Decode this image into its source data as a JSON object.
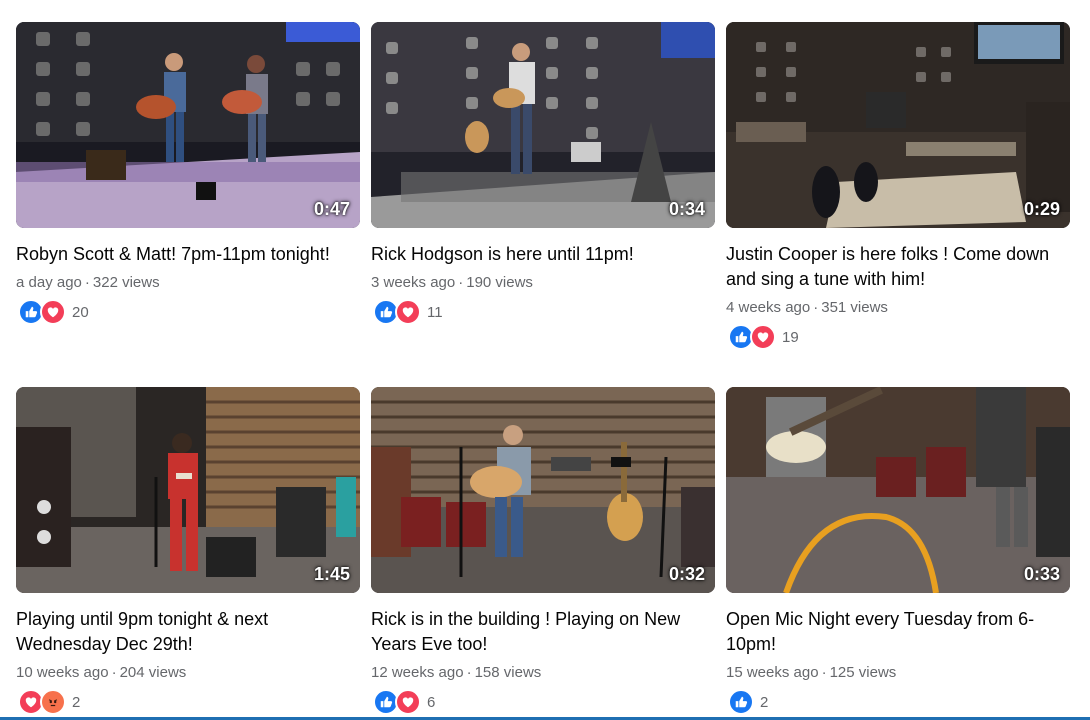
{
  "videos": [
    {
      "duration": "0:47",
      "title": "Robyn Scott & Matt! 7pm-11pm tonight!",
      "age": "a day ago",
      "views": "322 views",
      "reactions": [
        "like",
        "love"
      ],
      "count": "20"
    },
    {
      "duration": "0:34",
      "title": "Rick Hodgson is here until 11pm!",
      "age": "3 weeks ago",
      "views": "190 views",
      "reactions": [
        "like",
        "love"
      ],
      "count": "11"
    },
    {
      "duration": "0:29",
      "title": "Justin Cooper is here folks ! Come down and sing a tune with him!",
      "age": "4 weeks ago",
      "views": "351 views",
      "reactions": [
        "like",
        "love"
      ],
      "count": "19"
    },
    {
      "duration": "1:45",
      "title": "Playing until 9pm tonight & next Wednesday Dec 29th!",
      "age": "10 weeks ago",
      "views": "204 views",
      "reactions": [
        "love",
        "angry"
      ],
      "count": "2"
    },
    {
      "duration": "0:32",
      "title": "Rick is in the building ! Playing on New Years Eve too!",
      "age": "12 weeks ago",
      "views": "158 views",
      "reactions": [
        "like",
        "love"
      ],
      "count": "6"
    },
    {
      "duration": "0:33",
      "title": "Open Mic Night every Tuesday from 6-10pm!",
      "age": "15 weeks ago",
      "views": "125 views",
      "reactions": [
        "like"
      ],
      "count": "2"
    }
  ],
  "meta_separator": "·",
  "colors": {
    "like": "#1877f2",
    "love": "#f33e58",
    "angry": "#f7714c",
    "meta": "#65676b",
    "title": "#050505"
  }
}
